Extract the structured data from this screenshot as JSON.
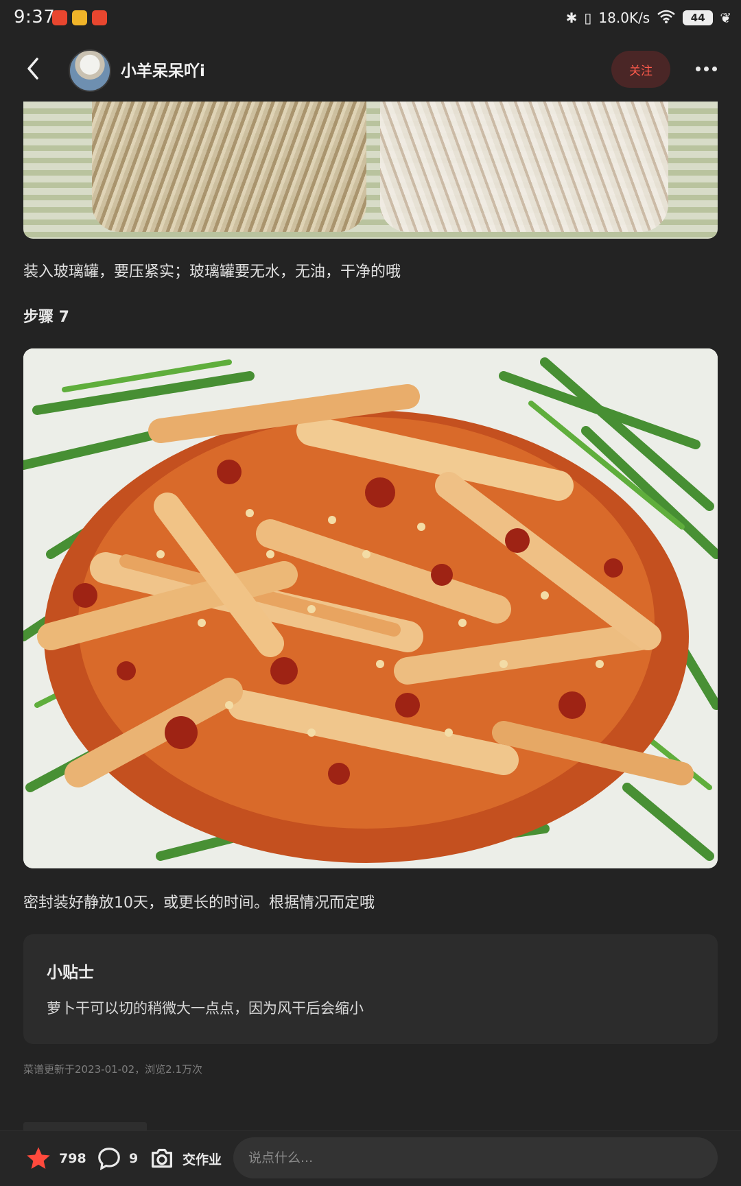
{
  "status_bar": {
    "time": "9:37",
    "network_speed": "18.0K/s",
    "battery": "44"
  },
  "header": {
    "author_name": "小羊呆呆吖i",
    "follow_label": "关注"
  },
  "content": {
    "step6_text": "装入玻璃罐，要压紧实；玻璃罐要无水，无油，干净的哦",
    "step7_title": "步骤 7",
    "step7_text": "密封装好静放10天，或更长的时间。根据情况而定哦"
  },
  "tips": {
    "title": "小贴士",
    "text": "萝卜干可以切的稍微大一点点，因为风干后会缩小"
  },
  "meta": {
    "updated_text": "菜谱更新于2023-01-02，浏览2.1万次"
  },
  "bottom_bar": {
    "favorite_count": "798",
    "comment_count": "9",
    "homework_label": "交作业",
    "comment_placeholder": "说点什么..."
  },
  "colors": {
    "background": "#232323",
    "accent_red": "#ff5a4c",
    "follow_bg": "#4a2626"
  }
}
